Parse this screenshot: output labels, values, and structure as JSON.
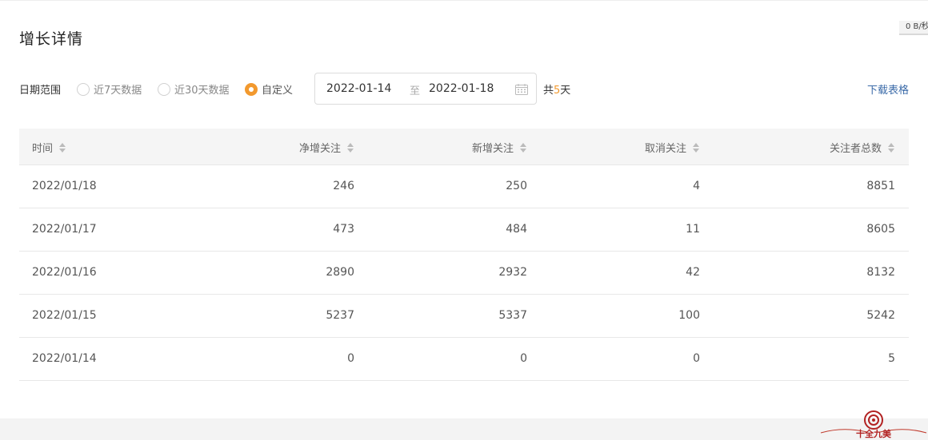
{
  "speed_badge": "0 B/秒",
  "title": "增长详情",
  "filter": {
    "label": "日期范围",
    "options": [
      {
        "label": "近7天数据",
        "checked": false
      },
      {
        "label": "近30天数据",
        "checked": false
      },
      {
        "label": "自定义",
        "checked": true
      }
    ],
    "date_start": "2022-01-14",
    "date_separator": "至",
    "date_end": "2022-01-18",
    "total_prefix": "共",
    "total_days": "5",
    "total_suffix": "天",
    "download_label": "下载表格"
  },
  "table": {
    "columns": [
      "时间",
      "净增关注",
      "新增关注",
      "取消关注",
      "关注者总数"
    ],
    "rows": [
      [
        "2022/01/18",
        "246",
        "250",
        "4",
        "8851"
      ],
      [
        "2022/01/17",
        "473",
        "484",
        "11",
        "8605"
      ],
      [
        "2022/01/16",
        "2890",
        "2932",
        "42",
        "8132"
      ],
      [
        "2022/01/15",
        "5237",
        "5337",
        "100",
        "5242"
      ],
      [
        "2022/01/14",
        "0",
        "0",
        "0",
        "5"
      ]
    ]
  },
  "watermark_text": "十全九美",
  "accent_color": "#f2992e",
  "link_color": "#3a6aa8"
}
